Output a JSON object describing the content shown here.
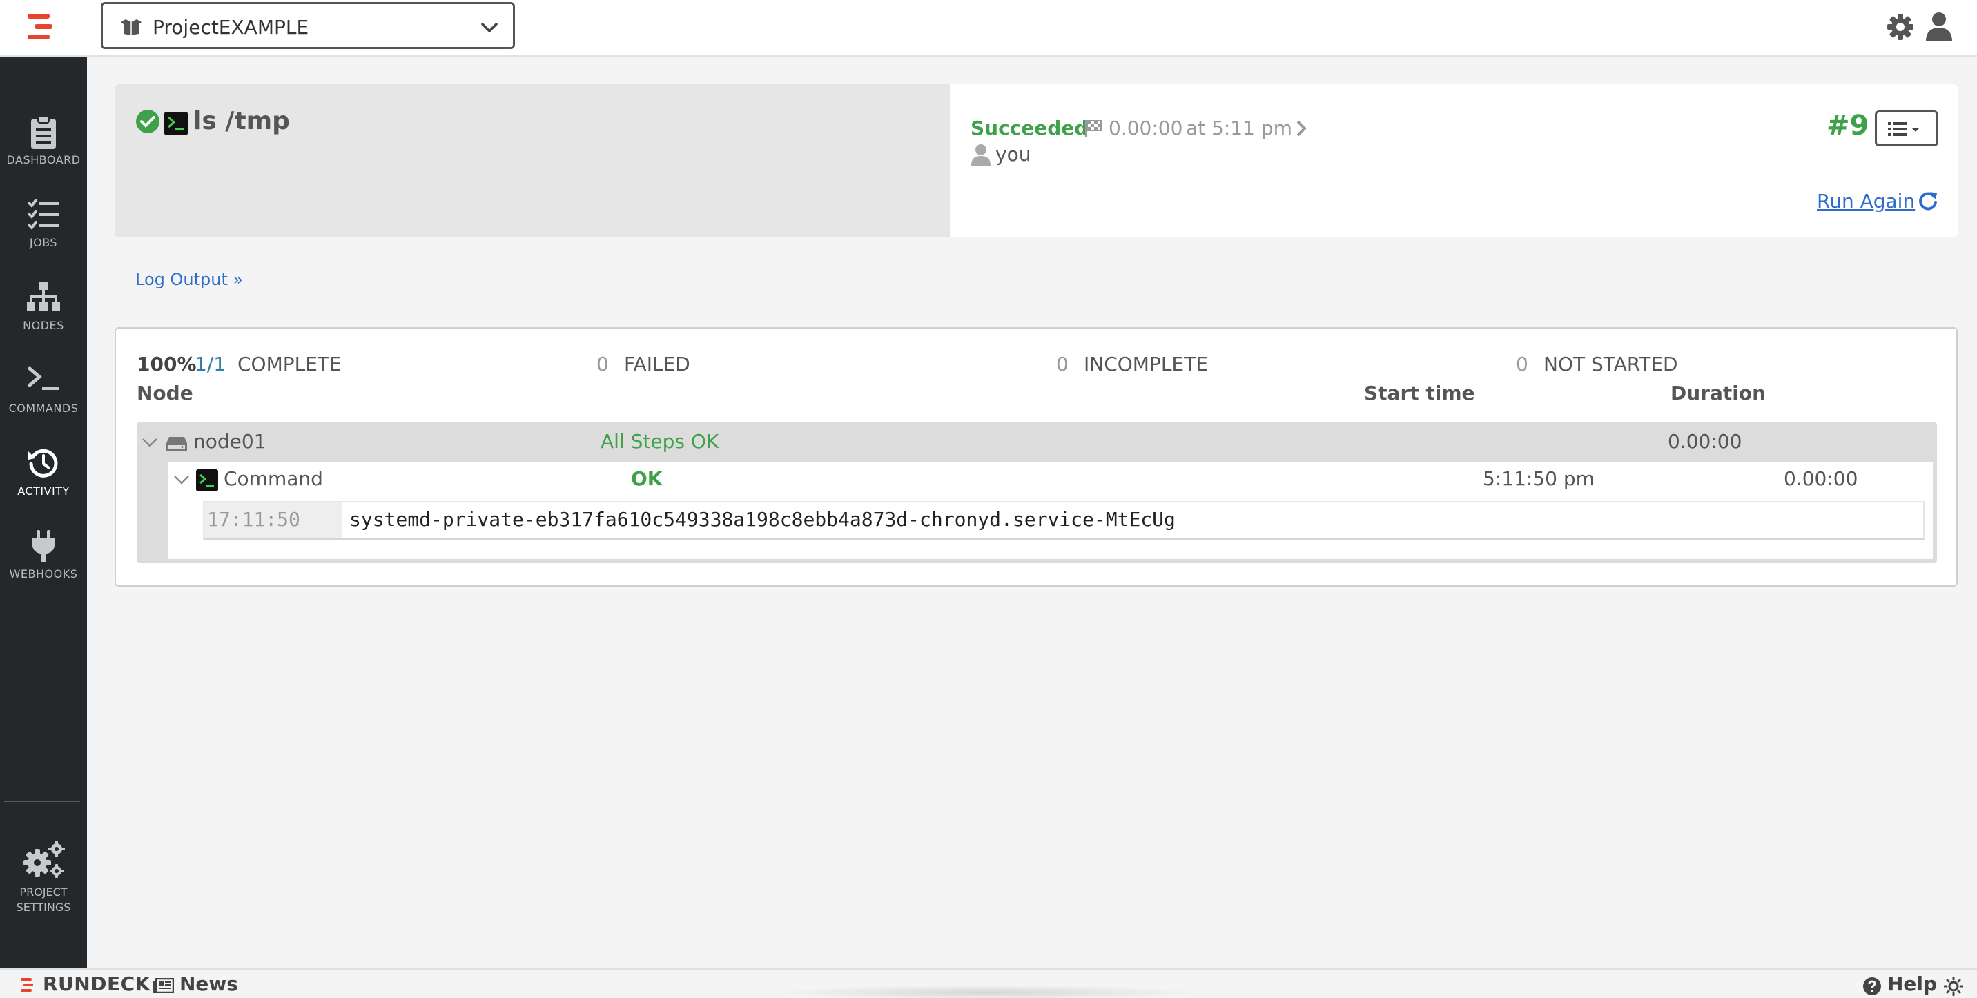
{
  "app": {
    "brand": "RUNDECK"
  },
  "project": {
    "name": "ProjectEXAMPLE"
  },
  "sidebar": {
    "items": [
      {
        "label": "DASHBOARD"
      },
      {
        "label": "JOBS"
      },
      {
        "label": "NODES"
      },
      {
        "label": "COMMANDS"
      },
      {
        "label": "ACTIVITY",
        "active": true
      },
      {
        "label": "WEBHOOKS"
      }
    ],
    "settings": {
      "line1": "PROJECT",
      "line2": "SETTINGS"
    }
  },
  "execution": {
    "title": "ls /tmp",
    "status": "Succeeded",
    "duration": "0.00:00",
    "at_time": "at 5:11 pm",
    "user": "you",
    "number": "#9",
    "run_again": "Run Again"
  },
  "log_output_link": "Log Output »",
  "summary": {
    "percent": "100%",
    "fraction": "1/1",
    "complete_label": "COMPLETE",
    "failed_count": "0",
    "failed_label": "FAILED",
    "incomplete_count": "0",
    "incomplete_label": "INCOMPLETE",
    "not_started_count": "0",
    "not_started_label": "NOT STARTED"
  },
  "table": {
    "headers": {
      "node": "Node",
      "start_time": "Start time",
      "duration": "Duration"
    },
    "node": {
      "name": "node01",
      "status": "All Steps OK",
      "duration": "0.00:00",
      "step": {
        "name": "Command",
        "status": "OK",
        "start_time": "5:11:50 pm",
        "duration": "0.00:00",
        "log": {
          "timestamp": "17:11:50",
          "message": "systemd-private-eb317fa610c549338a198c8ebb4a873d-chronyd.service-MtEcUg"
        }
      }
    }
  },
  "footer": {
    "news": "News",
    "help": "Help"
  },
  "colors": {
    "success": "#3fa14a",
    "link": "#2e6ec9",
    "brand": "#e8432e",
    "sidebar": "#25282b"
  }
}
